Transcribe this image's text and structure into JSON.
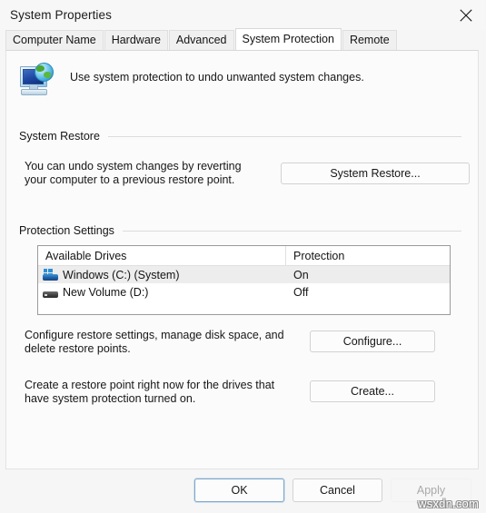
{
  "window": {
    "title": "System Properties",
    "close_icon": "close-icon"
  },
  "tabs": [
    {
      "label": "Computer Name",
      "active": false
    },
    {
      "label": "Hardware",
      "active": false
    },
    {
      "label": "Advanced",
      "active": false
    },
    {
      "label": "System Protection",
      "active": true
    },
    {
      "label": "Remote",
      "active": false
    }
  ],
  "header": {
    "icon": "computer-globe-icon",
    "text": "Use system protection to undo unwanted system changes."
  },
  "system_restore": {
    "group_title": "System Restore",
    "description": "You can undo system changes by reverting\nyour computer to a previous restore point.",
    "button_label": "System Restore..."
  },
  "protection_settings": {
    "group_title": "Protection Settings",
    "table": {
      "columns": [
        "Available Drives",
        "Protection"
      ],
      "rows": [
        {
          "icon": "windows-drive-icon",
          "drive": "Windows (C:) (System)",
          "protection": "On",
          "selected": true
        },
        {
          "icon": "hard-drive-icon",
          "drive": "New Volume (D:)",
          "protection": "Off",
          "selected": false
        }
      ]
    },
    "configure": {
      "description": "Configure restore settings, manage disk space, and\ndelete restore points.",
      "button_label": "Configure..."
    },
    "create": {
      "description": "Create a restore point right now for the drives that\nhave system protection turned on.",
      "button_label": "Create..."
    }
  },
  "footer": {
    "ok_label": "OK",
    "cancel_label": "Cancel",
    "apply_label": "Apply"
  },
  "watermark": {
    "text": "wsxdn.com"
  }
}
